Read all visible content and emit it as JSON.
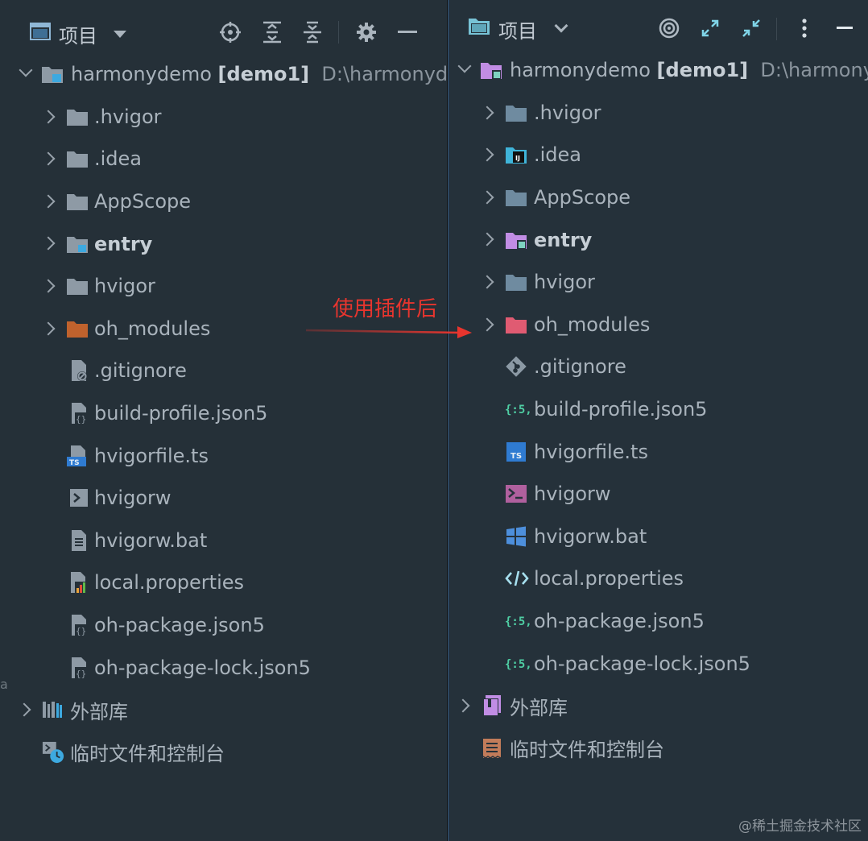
{
  "annotation": {
    "text": "使用插件后"
  },
  "watermark": "@稀土掘金技术社区",
  "left_panel": {
    "title": "项目",
    "tools": [
      "locate-icon",
      "expand-all-icon",
      "collapse-all-icon",
      "gear-icon",
      "minimize-icon"
    ],
    "root": {
      "name": "harmonydemo",
      "module": "[demo1]",
      "path": "D:\\harmonydemo"
    },
    "items": [
      {
        "label": ".hvigor",
        "icon": "folder-icon",
        "expandable": true
      },
      {
        "label": ".idea",
        "icon": "folder-icon",
        "expandable": true
      },
      {
        "label": "AppScope",
        "icon": "folder-icon",
        "expandable": true
      },
      {
        "label": "entry",
        "icon": "module-folder-icon",
        "expandable": true,
        "bold": true
      },
      {
        "label": "hvigor",
        "icon": "folder-icon",
        "expandable": true
      },
      {
        "label": "oh_modules",
        "icon": "excluded-folder-icon",
        "expandable": true
      },
      {
        "label": ".gitignore",
        "icon": "ignored-file-icon",
        "expandable": false
      },
      {
        "label": "build-profile.json5",
        "icon": "json5-file-icon",
        "expandable": false
      },
      {
        "label": "hvigorfile.ts",
        "icon": "typescript-file-icon",
        "expandable": false
      },
      {
        "label": "hvigorw",
        "icon": "shell-file-icon",
        "expandable": false
      },
      {
        "label": "hvigorw.bat",
        "icon": "text-file-icon",
        "expandable": false
      },
      {
        "label": "local.properties",
        "icon": "properties-file-icon",
        "expandable": false
      },
      {
        "label": "oh-package.json5",
        "icon": "json5-file-icon",
        "expandable": false
      },
      {
        "label": "oh-package-lock.json5",
        "icon": "json5-file-icon",
        "expandable": false
      }
    ],
    "external_libraries": "外部库",
    "scratches": "临时文件和控制台"
  },
  "right_panel": {
    "title": "项目",
    "tools": [
      "target-icon",
      "expand-icon",
      "collapse-icon",
      "more-icon",
      "minimize-icon"
    ],
    "root": {
      "name": "harmonydemo",
      "module": "[demo1]",
      "path": "D:\\harmonydemo"
    },
    "items": [
      {
        "label": ".hvigor",
        "icon": "folder-icon",
        "expandable": true
      },
      {
        "label": ".idea",
        "icon": "idea-folder-icon",
        "expandable": true
      },
      {
        "label": "AppScope",
        "icon": "folder-icon",
        "expandable": true
      },
      {
        "label": "entry",
        "icon": "module-folder-icon",
        "expandable": true,
        "bold": true
      },
      {
        "label": "hvigor",
        "icon": "folder-icon",
        "expandable": true
      },
      {
        "label": "oh_modules",
        "icon": "excluded-folder-icon",
        "expandable": true
      },
      {
        "label": ".gitignore",
        "icon": "git-icon",
        "expandable": false
      },
      {
        "label": "build-profile.json5",
        "icon": "json5-icon",
        "expandable": false
      },
      {
        "label": "hvigorfile.ts",
        "icon": "typescript-icon",
        "expandable": false
      },
      {
        "label": "hvigorw",
        "icon": "terminal-icon",
        "expandable": false
      },
      {
        "label": "hvigorw.bat",
        "icon": "windows-icon",
        "expandable": false
      },
      {
        "label": "local.properties",
        "icon": "code-icon",
        "expandable": false
      },
      {
        "label": "oh-package.json5",
        "icon": "json5-icon",
        "expandable": false
      },
      {
        "label": "oh-package-lock.json5",
        "icon": "json5-icon",
        "expandable": false
      }
    ],
    "external_libraries": "外部库",
    "scratches": "临时文件和控制台"
  },
  "colors": {
    "annotation": "#e8352e",
    "left_folder": "#8e9aa5",
    "left_excluded_folder": "#c0622d",
    "right_folder": "#6f8ba0",
    "right_module": "#c18de4",
    "right_excluded": "#e05b72",
    "json5": "#4fcfa4",
    "ts": "#2f7bd1",
    "terminal": "#b0609e",
    "windows": "#4d8fdc"
  }
}
